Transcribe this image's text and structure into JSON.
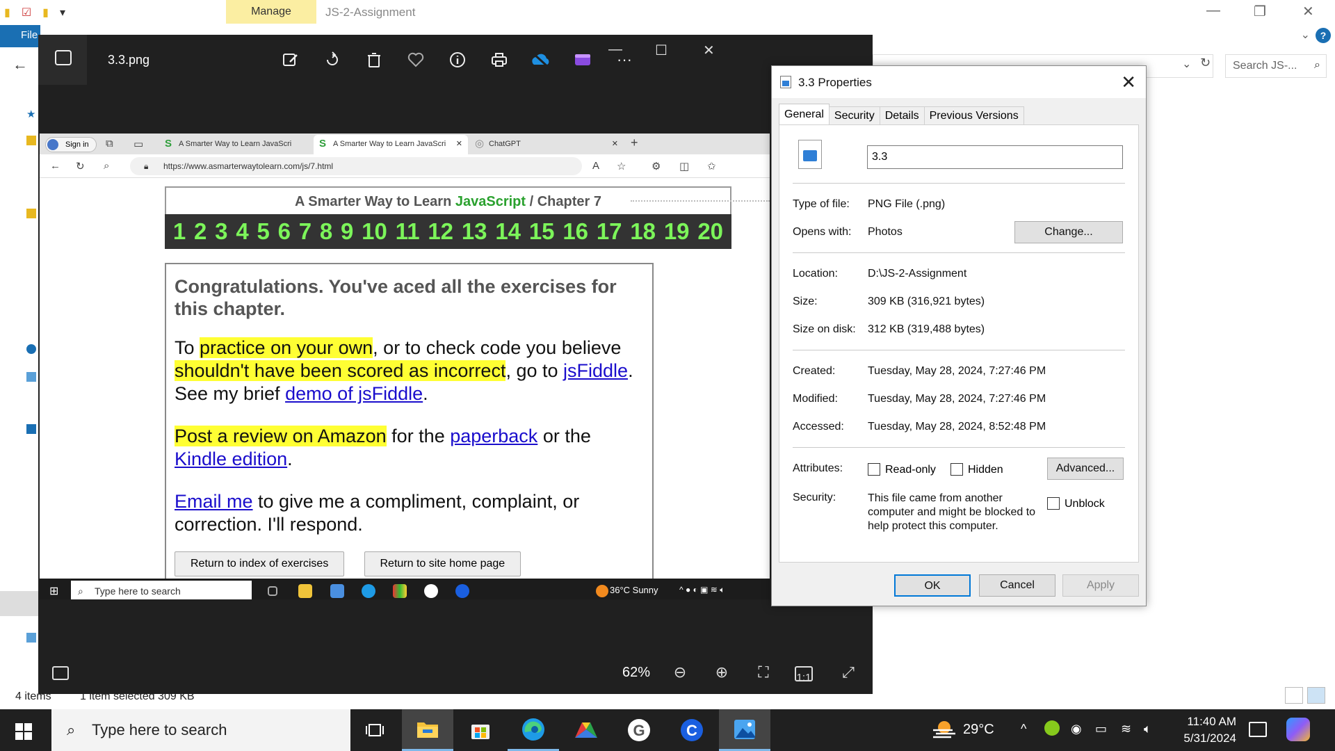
{
  "explorer": {
    "manage_tab": "Manage",
    "window_title": "JS-2-Assignment",
    "file_tab": "File",
    "search_placeholder": "Search JS-...",
    "status_items": "4 items",
    "status_selected": "1 item selected  309 KB"
  },
  "photos": {
    "filename": "3.3.png",
    "zoom": "62%",
    "toolbar_icons": [
      "edit-icon",
      "rotate-icon",
      "delete-icon",
      "favorite-icon",
      "info-icon",
      "print-icon",
      "onedrive-icon",
      "clipchamp-icon",
      "more-icon"
    ]
  },
  "screenshot": {
    "signin": "Sign in",
    "tabs": [
      {
        "label": "A Smarter Way to Learn JavaScri"
      },
      {
        "label": "A Smarter Way to Learn JavaScri"
      },
      {
        "label": "ChatGPT"
      }
    ],
    "url": "https://www.asmarterwaytolearn.com/js/7.html",
    "header_prefix": "A Smarter Way to Learn ",
    "header_js": "JavaScript",
    "header_suffix": "  /  Chapter 7",
    "chapters": [
      "1",
      "2",
      "3",
      "4",
      "5",
      "6",
      "7",
      "8",
      "9",
      "10",
      "11",
      "12",
      "13",
      "14",
      "15",
      "16",
      "17",
      "18",
      "19",
      "20"
    ],
    "congrats": "Congratulations. You've aced all the exercises for this chapter.",
    "p1_a": "To ",
    "p1_hl1": "practice on your own",
    "p1_b": ", or to check code you believe ",
    "p1_hl2": "shouldn't have been scored as incorrect",
    "p1_c": ", go to ",
    "p1_link1": "jsFiddle",
    "p1_d": ". See my brief ",
    "p1_link2": "demo of jsFiddle",
    "p1_e": ".",
    "p2_hl": "Post a review on Amazon",
    "p2_a": " for the ",
    "p2_link1": "paperback",
    "p2_b": " or the ",
    "p2_link2": "Kindle edition",
    "p2_c": ".",
    "p3_link": "Email me",
    "p3_a": " to give me a compliment, complaint, or correction. I'll respond.",
    "btn_index": "Return to index of exercises",
    "btn_home": "Return to site home page",
    "taskbar_search": "Type here to search",
    "weather": "36°C  Sunny"
  },
  "properties": {
    "title": "3.3 Properties",
    "tabs": [
      "General",
      "Security",
      "Details",
      "Previous Versions"
    ],
    "filename": "3.3",
    "type_label": "Type of file:",
    "type_value": "PNG File (.png)",
    "opens_label": "Opens with:",
    "opens_value": "Photos",
    "change_btn": "Change...",
    "location_label": "Location:",
    "location_value": "D:\\JS-2-Assignment",
    "size_label": "Size:",
    "size_value": "309 KB (316,921 bytes)",
    "disk_label": "Size on disk:",
    "disk_value": "312 KB (319,488 bytes)",
    "created_label": "Created:",
    "created_value": "Tuesday, May 28, 2024, 7:27:46 PM",
    "modified_label": "Modified:",
    "modified_value": "Tuesday, May 28, 2024, 7:27:46 PM",
    "accessed_label": "Accessed:",
    "accessed_value": "Tuesday, May 28, 2024, 8:52:48 PM",
    "attributes_label": "Attributes:",
    "readonly_label": "Read-only",
    "hidden_label": "Hidden",
    "advanced_btn": "Advanced...",
    "security_label": "Security:",
    "security_text": "This file came from another computer and might be blocked to help protect this computer.",
    "unblock_label": "Unblock",
    "ok": "OK",
    "cancel": "Cancel",
    "apply": "Apply"
  },
  "taskbar": {
    "search_placeholder": "Type here to search",
    "temperature": "29°C",
    "time": "11:40 AM",
    "date": "5/31/2024"
  },
  "colors": {
    "accent": "#0078d7",
    "chapter_green": "#7cf55a",
    "highlight": "#ffff33",
    "link": "#1a0dcc"
  }
}
